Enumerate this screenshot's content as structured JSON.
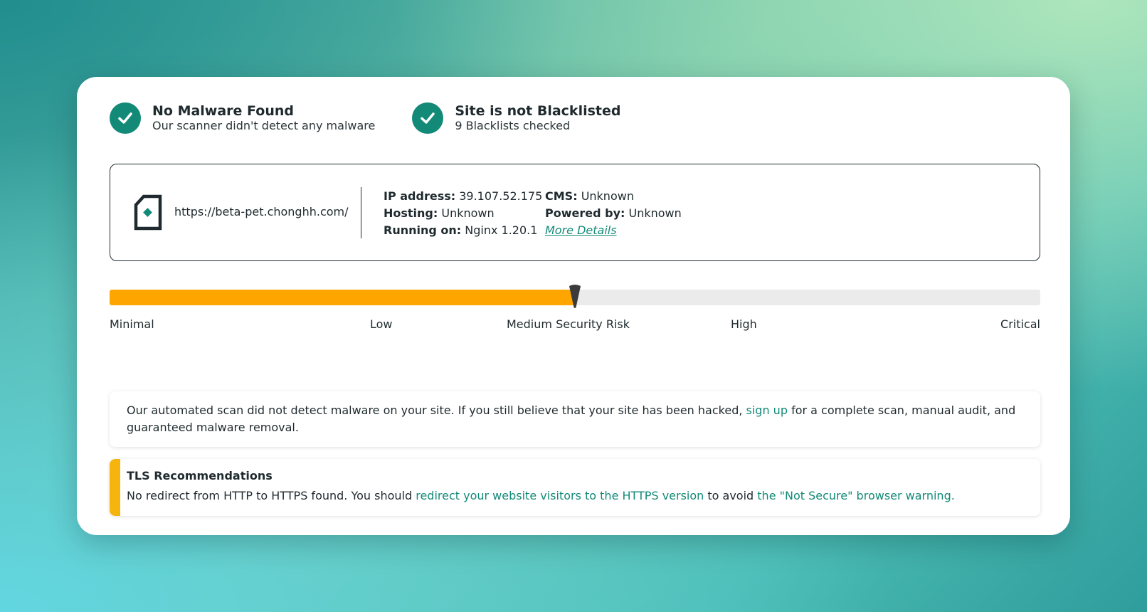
{
  "status": {
    "malware": {
      "icon": "check-circle-icon",
      "title": "No Malware Found",
      "subtitle": "Our scanner didn't detect any malware"
    },
    "blacklist": {
      "icon": "check-circle-icon",
      "title": "Site is not Blacklisted",
      "subtitle": "9 Blacklists checked"
    }
  },
  "site": {
    "icon": "site-document-icon",
    "url": "https://beta-pet.chonghh.com/",
    "ip_label": "IP address:",
    "ip_value": "39.107.52.175",
    "hosting_label": "Hosting:",
    "hosting_value": "Unknown",
    "running_label": "Running on:",
    "running_value": "Nginx 1.20.1",
    "cms_label": "CMS:",
    "cms_value": "Unknown",
    "powered_label": "Powered by:",
    "powered_value": "Unknown",
    "more_details": "More Details"
  },
  "risk": {
    "level_fraction": 0.5,
    "fill_color": "#ffa500",
    "track_color": "#ebebeb",
    "labels": {
      "minimal": "Minimal",
      "low": "Low",
      "medium": "Medium Security Risk",
      "high": "High",
      "critical": "Critical"
    }
  },
  "notice": {
    "text_before": "Our automated scan did not detect malware on your site. If you still believe that your site has been hacked, ",
    "link": "sign up",
    "text_after": " for a complete scan, manual audit, and guaranteed malware removal."
  },
  "tls": {
    "title": "TLS Recommendations",
    "text_before": "No redirect from HTTP to HTTPS found. You should ",
    "link1": "redirect your website visitors to the HTTPS version",
    "text_middle": " to avoid ",
    "link2": "the \"Not Secure\" browser warning."
  },
  "colors": {
    "accent": "#138a78",
    "warning": "#f6b40e"
  }
}
